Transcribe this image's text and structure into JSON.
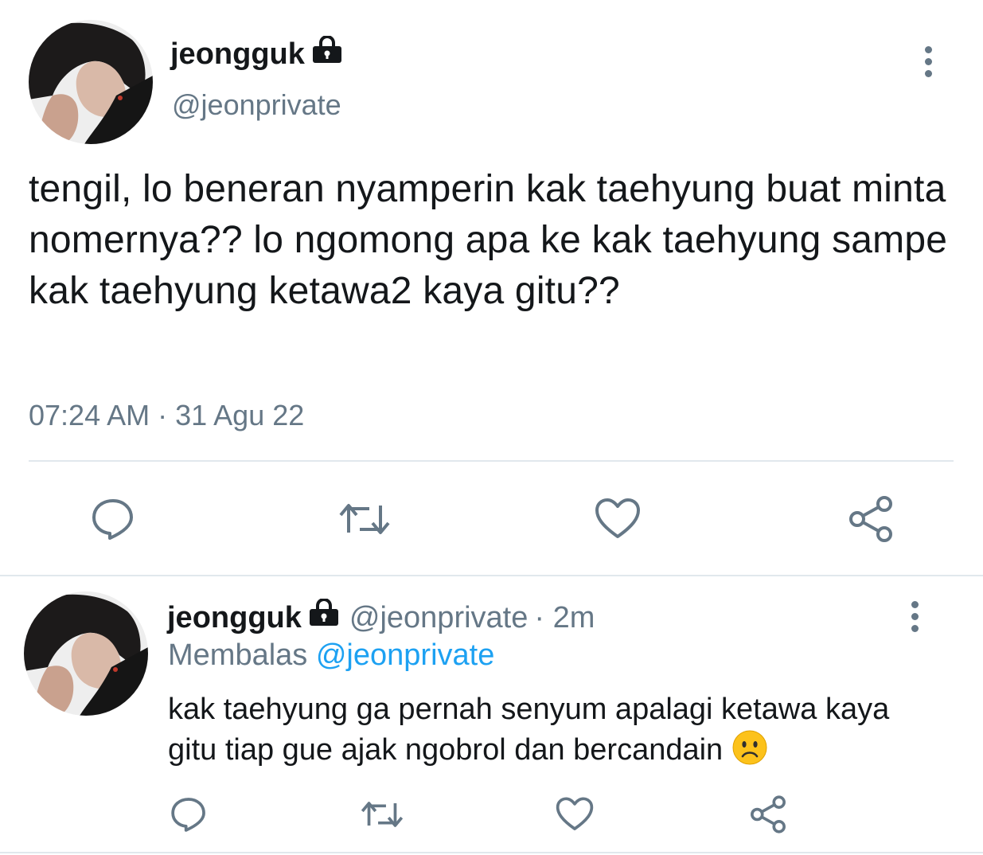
{
  "main_tweet": {
    "display_name": "jeongguk",
    "handle": "@jeonprivate",
    "text": "tengil, lo beneran nyamperin kak taehyung buat minta nomernya?? lo ngomong apa ke kak taehyung sampe kak taehyung ketawa2 kaya gitu??",
    "timestamp": "07:24 AM · 31 Agu 22"
  },
  "reply_tweet": {
    "display_name": "jeongguk",
    "handle": "@jeonprivate",
    "time_ago": "· 2m",
    "replying_prefix": "Membalas",
    "replying_to": "@jeonprivate",
    "text": "kak taehyung ga pernah senyum apalagi ketawa kaya gitu tiap gue ajak ngobrol dan bercandain"
  },
  "icons": {
    "lock": "lock-icon",
    "more": "more-vertical-icon",
    "reply": "comment-icon",
    "retweet": "retweet-icon",
    "like": "heart-icon",
    "share": "share-icon",
    "emoji": "frowning-face-emoji"
  },
  "colors": {
    "text": "#14171a",
    "muted": "#657786",
    "link": "#1da1f2",
    "divider": "#e1e8ed"
  }
}
